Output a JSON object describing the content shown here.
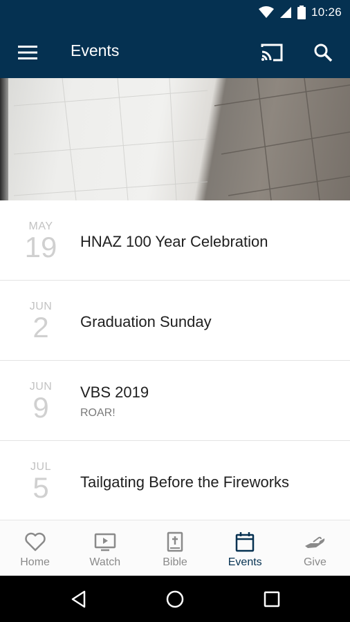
{
  "status_bar": {
    "time": "10:26"
  },
  "app_bar": {
    "title": "Events"
  },
  "events": [
    {
      "month": "MAY",
      "day": "19",
      "title": "HNAZ 100 Year Celebration",
      "subtitle": ""
    },
    {
      "month": "JUN",
      "day": "2",
      "title": "Graduation Sunday",
      "subtitle": ""
    },
    {
      "month": "JUN",
      "day": "9",
      "title": "VBS 2019",
      "subtitle": "ROAR!"
    },
    {
      "month": "JUL",
      "day": "5",
      "title": "Tailgating Before the Fireworks",
      "subtitle": ""
    }
  ],
  "bottom_nav": [
    {
      "label": "Home",
      "icon": "heart-icon"
    },
    {
      "label": "Watch",
      "icon": "tv-play-icon"
    },
    {
      "label": "Bible",
      "icon": "bible-icon"
    },
    {
      "label": "Events",
      "icon": "calendar-icon",
      "active": true
    },
    {
      "label": "Give",
      "icon": "giving-hand-icon"
    }
  ],
  "colors": {
    "primary": "#053151",
    "nav_inactive": "#8a8a8a",
    "date_gray": "#c2c2c2"
  }
}
